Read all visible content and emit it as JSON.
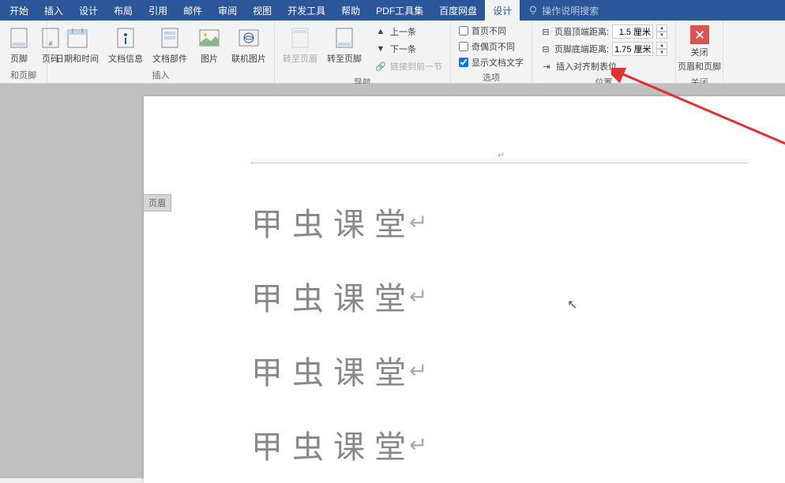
{
  "menu": {
    "items": [
      "开始",
      "插入",
      "设计",
      "布局",
      "引用",
      "邮件",
      "审阅",
      "视图",
      "开发工具",
      "帮助",
      "PDF工具集",
      "百度网盘"
    ],
    "active": "设计",
    "tell_me": "操作说明搜索"
  },
  "ribbon": {
    "groups": {
      "header_footer": {
        "label": "和页脚",
        "item1": "页脚",
        "item2": "页码"
      },
      "insert": {
        "label": "插入",
        "datetime": "日期和时间",
        "docinfo": "文档信息",
        "docparts": "文档部件",
        "picture": "图片",
        "online_pic": "联机图片"
      },
      "navigation": {
        "label": "导航",
        "goto_header": "转至页眉",
        "goto_footer": "转至页脚",
        "prev": "上一条",
        "next": "下一条",
        "link_prev": "链接到前一节"
      },
      "options": {
        "label": "选项",
        "first_diff": "首页不同",
        "odd_even_diff": "奇偶页不同",
        "show_doc_text": "显示文档文字"
      },
      "position": {
        "label": "位置",
        "header_top": "页眉顶端距离:",
        "footer_bottom": "页脚底端距离:",
        "insert_align_tab": "插入对齐制表位",
        "header_top_val": "1.5 厘米",
        "footer_bottom_val": "1.75 厘米"
      },
      "close": {
        "label": "关闭",
        "line1": "关闭",
        "line2": "页眉和页脚"
      }
    }
  },
  "document": {
    "header_label": "页眉",
    "body_lines": [
      "甲虫课堂",
      "甲虫课堂",
      "甲虫课堂",
      "甲虫课堂"
    ]
  }
}
